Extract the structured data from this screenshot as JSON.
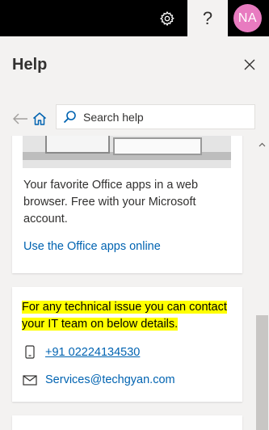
{
  "topbar": {
    "help_glyph": "?",
    "avatar_initials": "NA",
    "avatar_color": "#e87bc0"
  },
  "panel": {
    "title": "Help"
  },
  "search": {
    "placeholder": "Search help"
  },
  "office_card": {
    "description": "Your favorite Office apps in a web browser. Free with your Microsoft account.",
    "link_label": "Use the Office apps online"
  },
  "support_card": {
    "note": "For any technical issue you can contact your IT team on below details.",
    "highlight_color": "#ffff00",
    "phone": "+91 02224134530",
    "email": "Services@techgyan.com"
  },
  "colors": {
    "accent": "#0063b1",
    "topbar": "#000000"
  }
}
